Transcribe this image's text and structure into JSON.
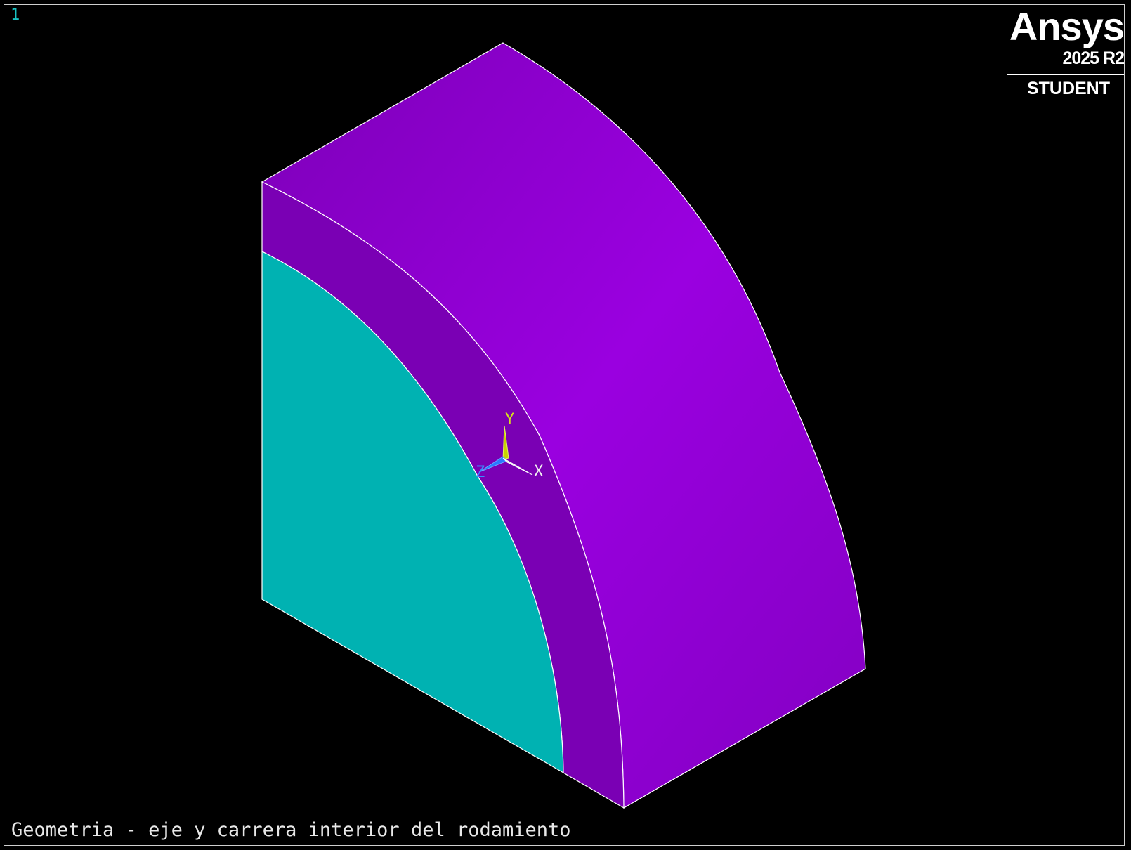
{
  "viewport": {
    "window_number": "1",
    "caption": "Geometria - eje y carrera interior del rodamiento",
    "background_color": "#000000"
  },
  "logo": {
    "name": "Ansys",
    "version": "2025 R2",
    "edition": "STUDENT"
  },
  "triad": {
    "x_label": "X",
    "y_label": "Y",
    "z_label": "Z"
  },
  "colors": {
    "shaft_face": "#00b2b2",
    "race_face": "#7a00b4",
    "race_cylindrical_surface": "#9a00e0",
    "edge_lines": "#ffffff",
    "window_number": "#19c3c3",
    "triad_y": "#c8d400",
    "triad_z": "#2a78ff",
    "triad_x": "#e8e8e8"
  }
}
